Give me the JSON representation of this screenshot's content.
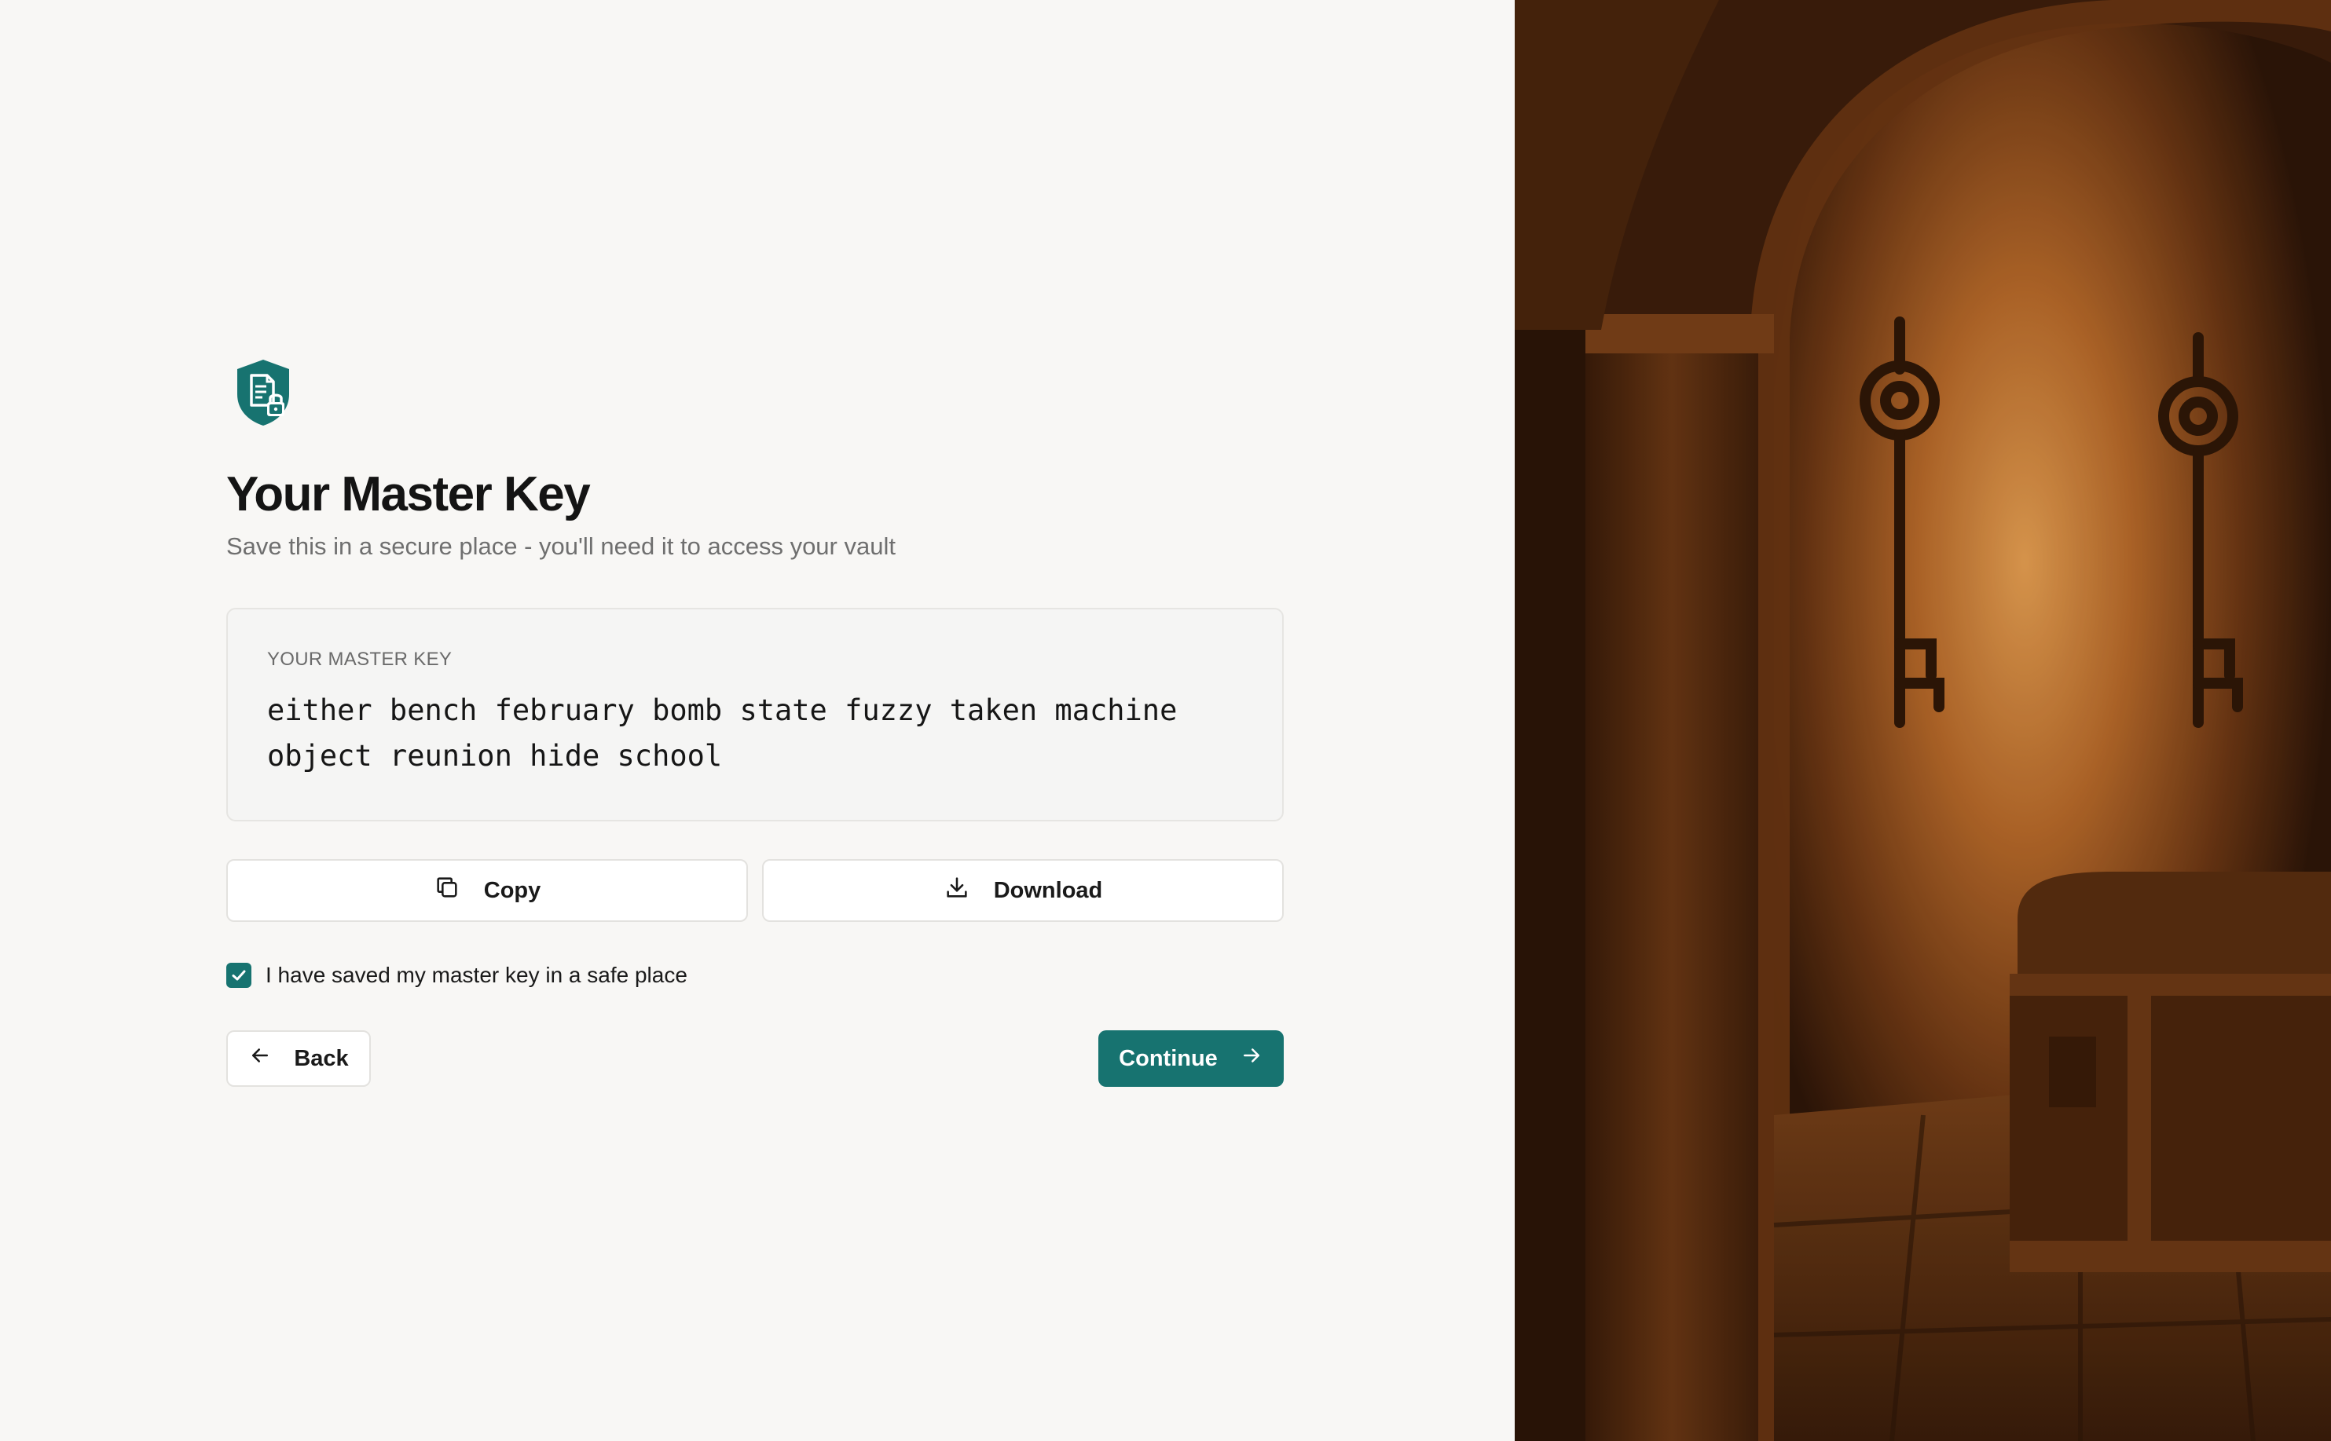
{
  "icons": {
    "logo": "shield-document-lock-icon",
    "copy": "copy-icon",
    "download": "download-icon",
    "check": "checkmark-icon",
    "back": "arrow-left-icon",
    "continue": "arrow-right-icon"
  },
  "colors": {
    "accent": "#177370",
    "background": "#f8f7f5",
    "illustration_tone": "#8a4a1c"
  },
  "header": {
    "title": "Your Master Key",
    "subtitle": "Save this in a secure place - you'll need it to access your vault"
  },
  "key_box": {
    "label": "YOUR MASTER KEY",
    "phrase": "either bench february bomb state fuzzy taken machine object reunion hide school"
  },
  "actions": {
    "copy_label": "Copy",
    "download_label": "Download"
  },
  "confirm": {
    "label": "I have saved my master key in a safe place",
    "checked": true
  },
  "nav": {
    "back_label": "Back",
    "continue_label": "Continue"
  },
  "illustration": {
    "subject": "vault chamber with hanging keys and treasure chest"
  }
}
